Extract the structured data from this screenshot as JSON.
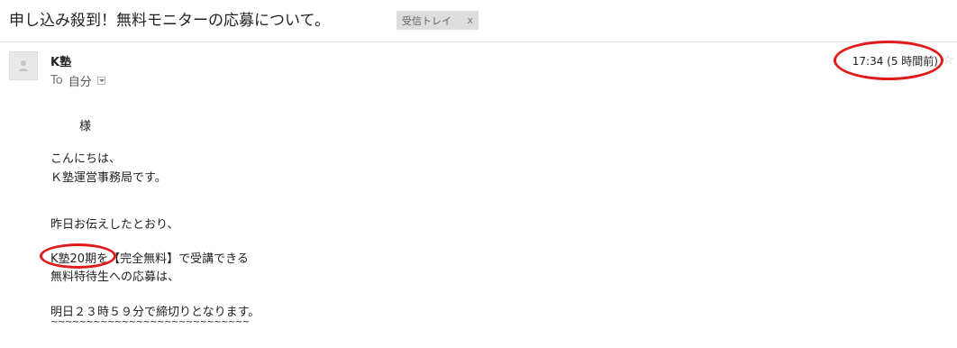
{
  "email": {
    "subject": "申し込み殺到！無料モニターの応募について。",
    "label_chip": {
      "text": "受信トレイ",
      "close": "x"
    },
    "sender": {
      "name": "K塾",
      "avatar_icon": "person-icon"
    },
    "recipient": {
      "prefix": "To",
      "value": "自分"
    },
    "timestamp": "17:34 (5 時間前)",
    "star_icon": "star-icon",
    "body": {
      "salutation": "様",
      "greeting_1": "こんにちは、",
      "greeting_2": "Ｋ塾運営事務局です。",
      "line_1": "昨日お伝えしたとおり、",
      "line_2_highlight": "K塾20期を",
      "line_2_rest": "【完全無料】で受講できる",
      "line_3": "無料特待生への応募は、",
      "line_4": "明日２３時５９分で締切りとなります。",
      "line_5": "~~~~~~~~~~~~~~~~~~~~~~~~~~~~"
    },
    "annotation_color": "#e01b1b"
  }
}
